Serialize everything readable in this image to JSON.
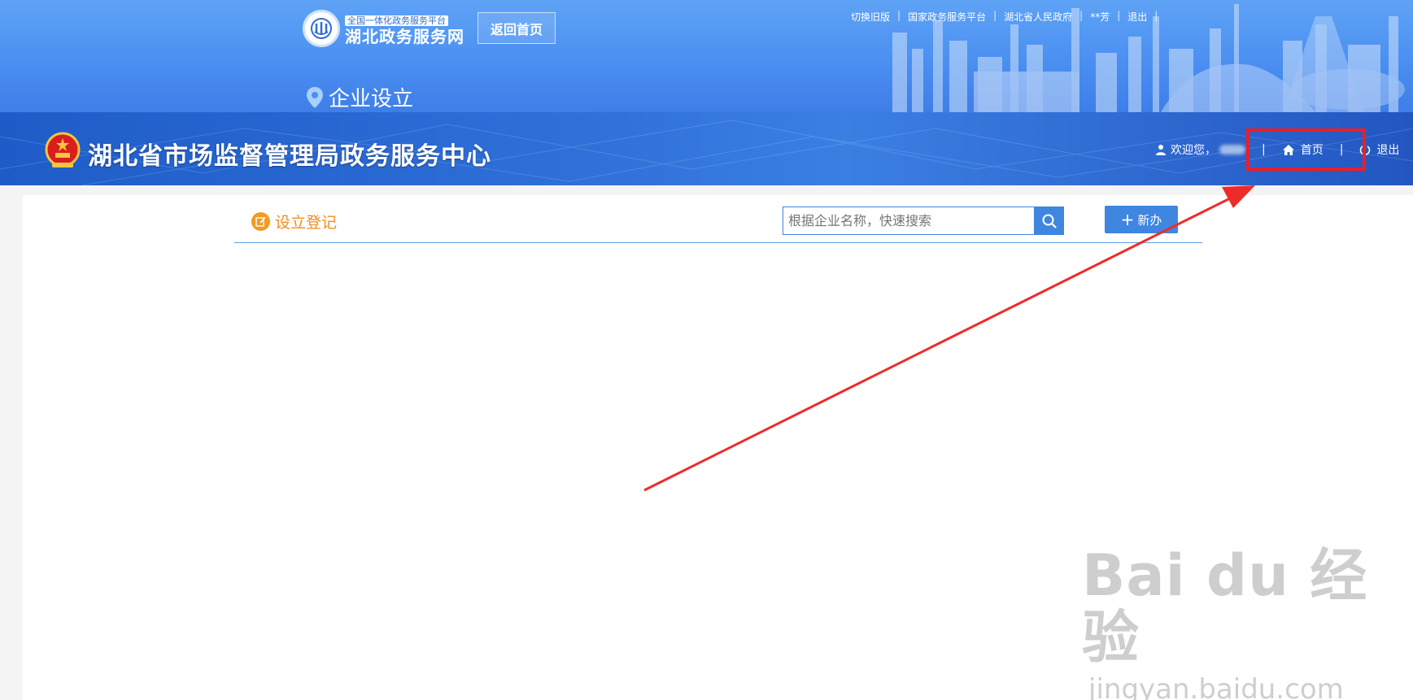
{
  "portal": {
    "logo_tag": "全国一体化政务服务平台",
    "logo_name": "湖北政务服务网",
    "back_home": "返回首页",
    "links": [
      "切换旧版",
      "国家政务服务平台",
      "湖北省人民政府",
      "**芳",
      "退出"
    ],
    "section_title": "企业设立"
  },
  "bureau": {
    "title": "湖北省市场监督管理局政务服务中心",
    "welcome": "欢迎您，",
    "home": "首页",
    "logout": "退出"
  },
  "main": {
    "register_title": "设立登记",
    "search_placeholder": "根据企业名称，快速搜索",
    "new_label": "新办"
  },
  "watermark": {
    "brand": "Bai du 经验",
    "url": "jingyan.baidu.com"
  },
  "colors": {
    "accent_blue": "#3e86e0",
    "highlight_red": "#ee1d24",
    "orange": "#f28c1e"
  }
}
